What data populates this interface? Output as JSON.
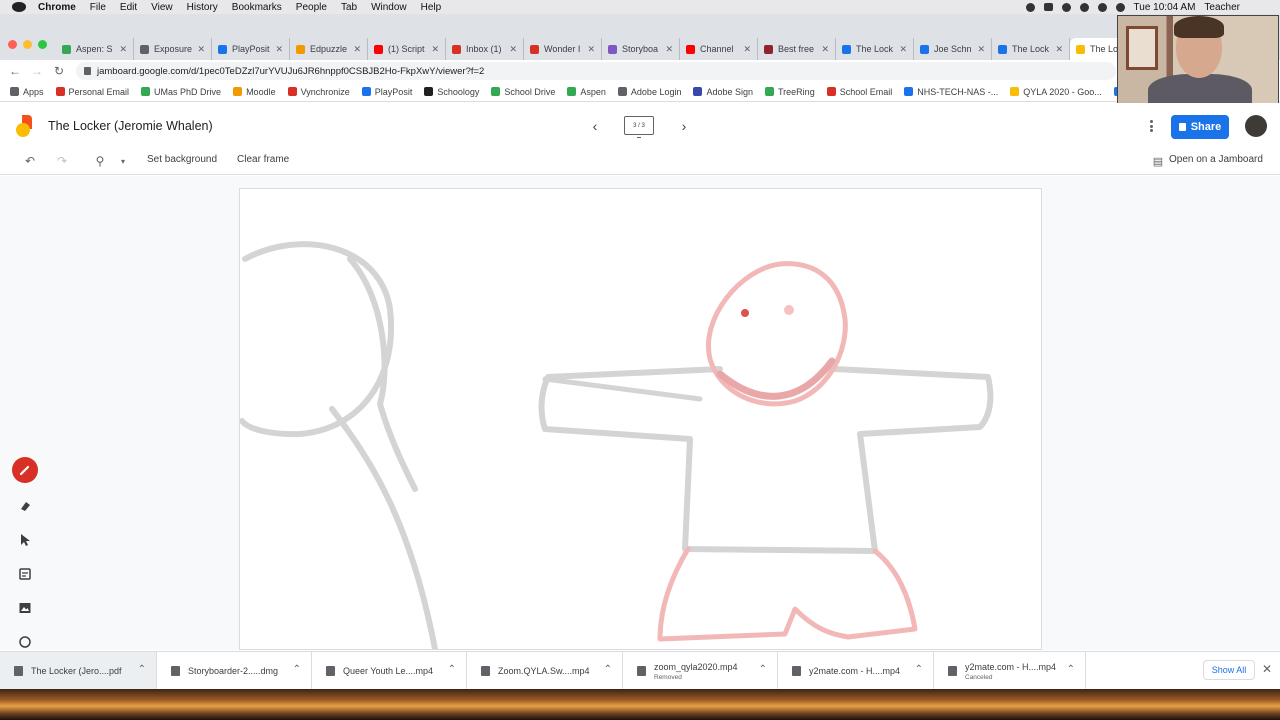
{
  "mac_menubar": {
    "app": "Chrome",
    "menus": [
      "File",
      "Edit",
      "View",
      "History",
      "Bookmarks",
      "People",
      "Tab",
      "Window",
      "Help"
    ],
    "clock": "Tue 10:04 AM",
    "user": "Teacher"
  },
  "tabs": [
    {
      "label": "Aspen: S",
      "color": "#34a853"
    },
    {
      "label": "Exposure",
      "color": "#5f6368"
    },
    {
      "label": "PlayPosit",
      "color": "#1a73e8"
    },
    {
      "label": "Edpuzzle",
      "color": "#f29900"
    },
    {
      "label": "(1) Script",
      "color": "#ff0000"
    },
    {
      "label": "Inbox (1)",
      "color": "#d93025"
    },
    {
      "label": "Wonder I",
      "color": "#d93025"
    },
    {
      "label": "Storyboa",
      "color": "#7e57c2"
    },
    {
      "label": "Channel",
      "color": "#ff0000"
    },
    {
      "label": "Best free",
      "color": "#8e2430"
    },
    {
      "label": "The Lock",
      "color": "#1a73e8"
    },
    {
      "label": "Joe Schn",
      "color": "#1a73e8"
    },
    {
      "label": "The Lock",
      "color": "#1a73e8"
    },
    {
      "label": "The Lo",
      "color": "#fbbc04",
      "active": true
    }
  ],
  "address": {
    "url": "jamboard.google.com/d/1pec0TeDZzl7urYVUJu6JR6hnppf0CSBJB2Ho-FkpXwY/viewer?f=2"
  },
  "bookmarks": [
    {
      "label": "Apps",
      "color": "#5f6368"
    },
    {
      "label": "Personal Email",
      "color": "#d93025"
    },
    {
      "label": "UMas PhD Drive",
      "color": "#34a853"
    },
    {
      "label": "Moodle",
      "color": "#f29900"
    },
    {
      "label": "Vynchronize",
      "color": "#d93025"
    },
    {
      "label": "PlayPosit",
      "color": "#1a73e8"
    },
    {
      "label": "Schoology",
      "color": "#202124"
    },
    {
      "label": "School Drive",
      "color": "#34a853"
    },
    {
      "label": "Aspen",
      "color": "#34a853"
    },
    {
      "label": "Adobe Login",
      "color": "#5f6368"
    },
    {
      "label": "Adobe Sign",
      "color": "#3949ab"
    },
    {
      "label": "TreeRing",
      "color": "#34a853"
    },
    {
      "label": "School Email",
      "color": "#d93025"
    },
    {
      "label": "NHS-TECH-NAS -...",
      "color": "#1a73e8"
    },
    {
      "label": "QYLA 2020 - Goo...",
      "color": "#fbbc04"
    },
    {
      "label": "NH",
      "color": "#1a73e8"
    }
  ],
  "jamboard": {
    "title": "The Locker (Jeromie Whalen)",
    "frame_indicator": "3 / 3",
    "share_label": "Share",
    "toolbar": {
      "set_background": "Set background",
      "clear_frame": "Clear frame",
      "open_on_jamboard": "Open on a Jamboard"
    }
  },
  "downloads": [
    {
      "name": "The Locker (Jero....pdf",
      "status": ""
    },
    {
      "name": "Storyboarder-2.....dmg",
      "status": ""
    },
    {
      "name": "Queer Youth Le....mp4",
      "status": ""
    },
    {
      "name": "Zoom.QYLA.Sw....mp4",
      "status": ""
    },
    {
      "name": "zoom_qyla2020.mp4",
      "status": "Removed"
    },
    {
      "name": "y2mate.com - H....mp4",
      "status": ""
    },
    {
      "name": "y2mate.com - H....mp4",
      "status": "Canceled"
    }
  ],
  "downloads_show_all": "Show All",
  "colors": {
    "accent": "#1a73e8",
    "pen_active": "#d93025",
    "stroke_gray": "#d0d0d0",
    "stroke_pink": "#f2b8b8"
  }
}
